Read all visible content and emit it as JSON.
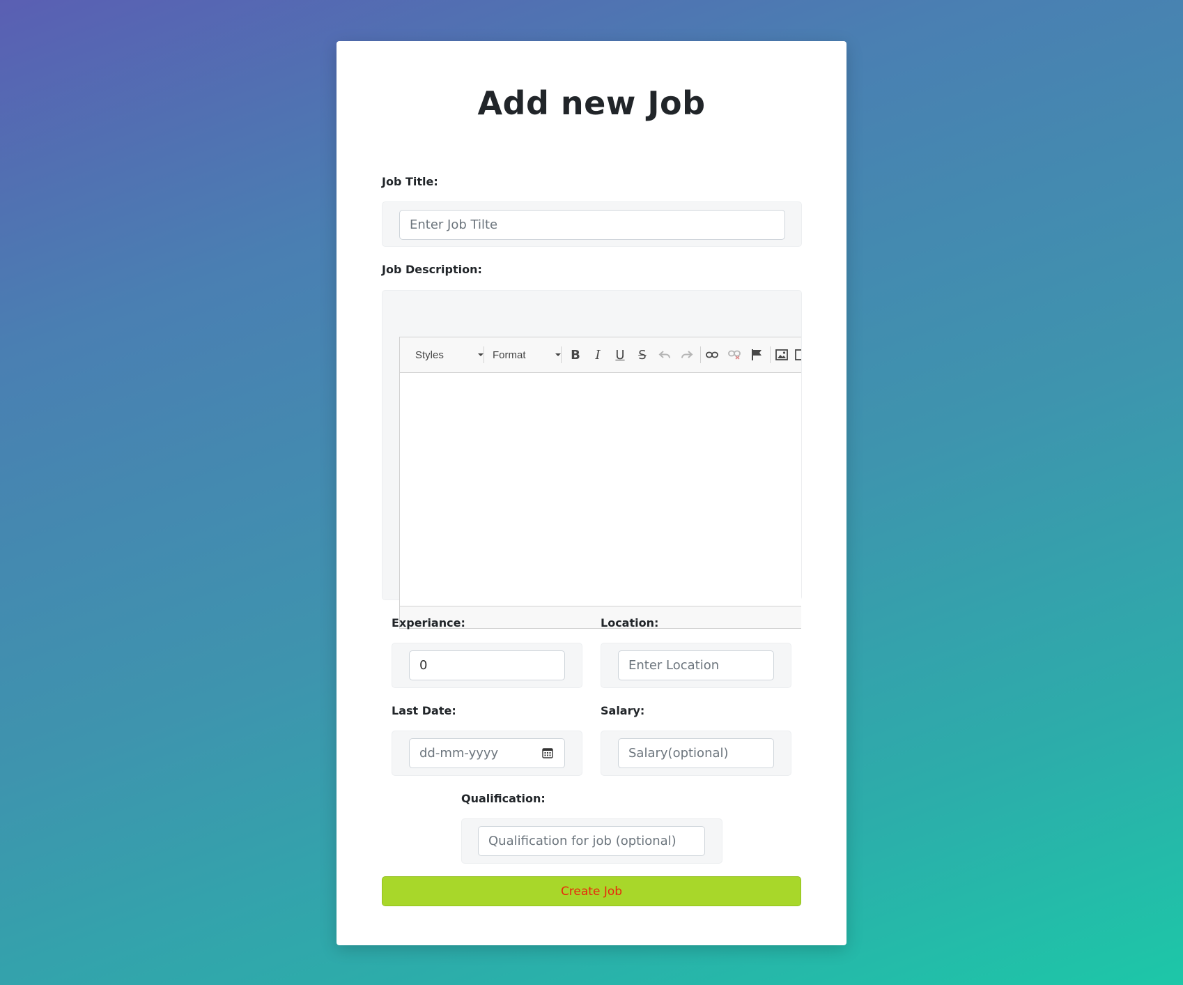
{
  "page": {
    "title": "Add new Job"
  },
  "job_title": {
    "label": "Job Title:",
    "placeholder": "Enter Job Tilte"
  },
  "job_description": {
    "label": "Job Description:",
    "toolbar": {
      "styles_label": "Styles",
      "format_label": "Format",
      "buttons": [
        "bold-icon",
        "italic-icon",
        "underline-icon",
        "strikethrough-icon",
        "undo-icon",
        "redo-icon",
        "link-icon",
        "unlink-icon",
        "anchor-flag-icon",
        "image-icon"
      ]
    }
  },
  "experience": {
    "label": "Experiance:",
    "value": "0"
  },
  "location": {
    "label": "Location:",
    "placeholder": "Enter Location"
  },
  "last_date": {
    "label": "Last Date:",
    "placeholder": "dd-mm-yyyy"
  },
  "salary": {
    "label": "Salary:",
    "placeholder": "Salary(optional)"
  },
  "qualification": {
    "label": "Qualification:",
    "placeholder": "Qualification for job (optional)"
  },
  "submit": {
    "label": "Create Job"
  },
  "colors": {
    "submit_bg": "#a8d72a",
    "submit_text": "#e8290b",
    "gradient_start": "#5a5fb3",
    "gradient_end": "#1dc7a8"
  }
}
